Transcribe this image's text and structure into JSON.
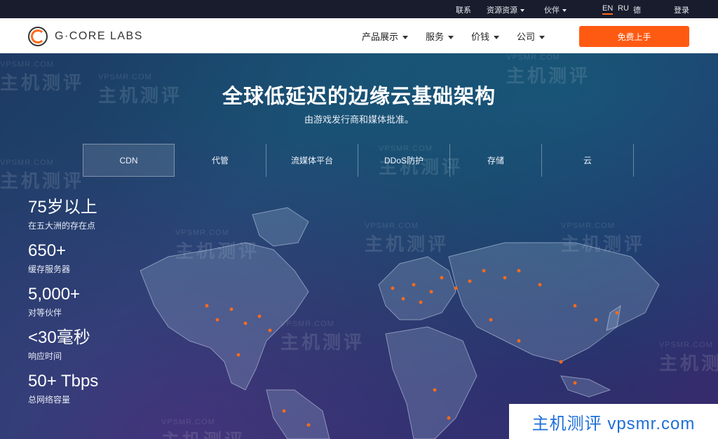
{
  "topbar": {
    "contact": "联系",
    "resources": "资源资源",
    "partners": "伙伴",
    "lang_en": "EN",
    "lang_ru": "RU",
    "lang_de": "德",
    "login": "登录"
  },
  "nav": {
    "logo_text": "G·CORE LABS",
    "products": "产品展示",
    "services": "服务",
    "pricing": "价钱",
    "company": "公司",
    "cta": "免费上手"
  },
  "hero": {
    "title": "全球低延迟的边缘云基础架构",
    "subtitle": "由游戏发行商和媒体批准。",
    "tabs": [
      "CDN",
      "代管",
      "流媒体平台",
      "DDoS防护",
      "存储",
      "云"
    ],
    "active_tab": "CDN",
    "stats": [
      {
        "value": "75岁以上",
        "label": "在五大洲的存在点"
      },
      {
        "value": "650+",
        "label": "缓存服务器"
      },
      {
        "value": "5,000+",
        "label": "对等伙伴"
      },
      {
        "value": "<30毫秒",
        "label": "响应时间"
      },
      {
        "value": "50+ Tbps",
        "label": "总网络容量"
      }
    ]
  },
  "watermark": {
    "text": "主机测评",
    "domain": "VPSMR.COM"
  },
  "badge": "主机测评  vpsmr.com",
  "colors": {
    "accent": "#ff5a12",
    "topbar": "#181c2c",
    "map_dot": "#ff6a1a"
  },
  "icons": [
    "logo-icon",
    "chevron-down-icon"
  ]
}
